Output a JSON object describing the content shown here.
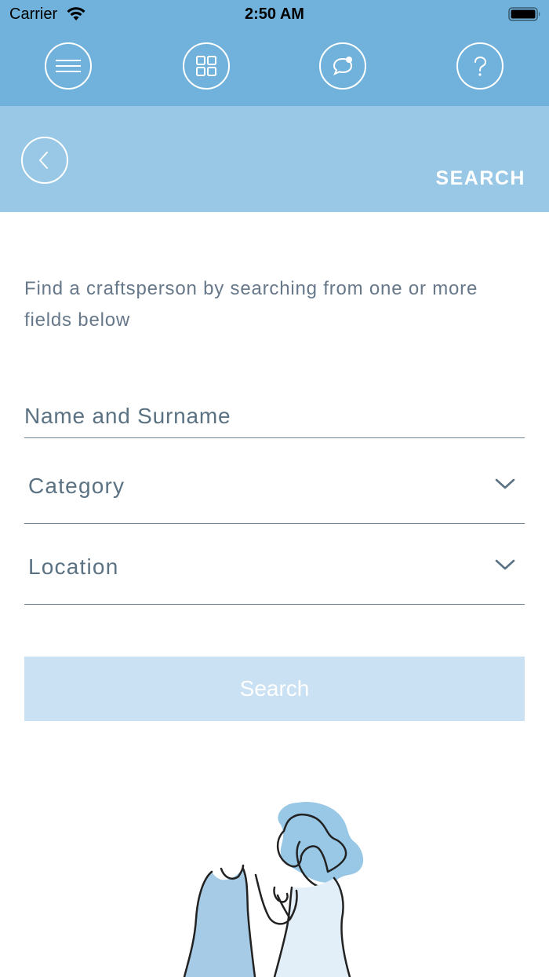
{
  "status_bar": {
    "carrier": "Carrier",
    "time": "2:50 AM"
  },
  "nav": {
    "icons": [
      "menu-icon",
      "grid-icon",
      "chat-bubble-icon",
      "help-icon"
    ]
  },
  "header": {
    "title": "SEARCH",
    "back_icon": "chevron-left-icon"
  },
  "intro_text": "Find a craftsperson by searching from one or more fields below",
  "form": {
    "name_placeholder": "Name and Surname",
    "category_label": "Category",
    "location_label": "Location",
    "search_label": "Search"
  },
  "colors": {
    "nav_blue": "#70b2db",
    "header_blue": "#98c8e6",
    "button_disabled": "#c9e1f2",
    "text_slate": "#5b7283"
  }
}
